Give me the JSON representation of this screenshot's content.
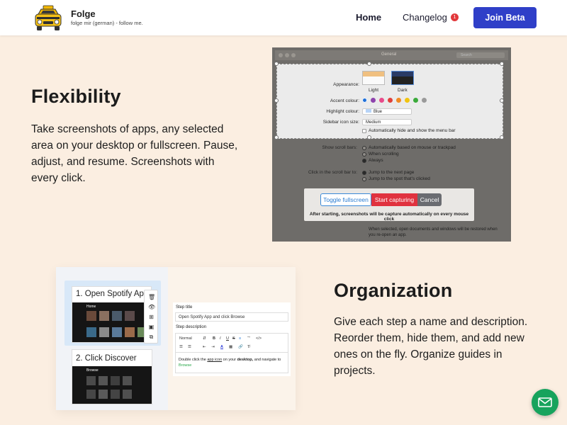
{
  "header": {
    "brand": "Folge",
    "tagline": "folge mir (german) - follow me.",
    "nav": {
      "home": "Home",
      "changelog": "Changelog",
      "changelog_badge": "1"
    },
    "cta": "Join Beta"
  },
  "flexibility": {
    "title": "Flexibility",
    "text": "Take screenshots of apps, any selected area on your desktop or fullscreen. Pause, adjust, and resume. Screenshots with every click."
  },
  "organization": {
    "title": "Organization",
    "text": "Give each step a name and description. Reorder them, hide them, and add new ones on the fly. Organize guides in projects."
  },
  "settings_window": {
    "title": "General",
    "search_placeholder": "Search",
    "appearance_label": "Appearance:",
    "light": "Light",
    "dark": "Dark",
    "accent_label": "Accent colour:",
    "accent_colors": [
      "#1e6fd8",
      "#8e44ad",
      "#e84b8a",
      "#e0403a",
      "#f08a24",
      "#f1c40f",
      "#3aaa3a",
      "#9a9a9a"
    ],
    "highlight_label": "Highlight colour:",
    "highlight_value": "Blue",
    "sidebar_label": "Sidebar icon size:",
    "sidebar_value": "Medium",
    "menu_bar_option": "Automatically hide and show the menu bar",
    "scroll_label": "Show scroll bars:",
    "scroll_options": [
      "Automatically based on mouse or trackpad",
      "When scrolling",
      "Always"
    ],
    "click_label": "Click in the scroll bar to:",
    "click_options": [
      "Jump to the next page",
      "Jump to the spot that's clicked"
    ],
    "restore_note": "When selected, open documents and windows will be restored when you re-open an app."
  },
  "capture_bar": {
    "toggle": "Toggle fullscreen",
    "start": "Start capturing",
    "cancel": "Cancel",
    "note": "After starting, screenshots will be capture automatically on every mouse click"
  },
  "guide_editor": {
    "step1_title": "1. Open Spotify Ap...",
    "step2_title": "2. Click Discover",
    "app_home_label": "Home",
    "app_browse_label": "Browse",
    "step_title_label": "Step title",
    "step_title_value": "Open Spotify App and click Browse",
    "step_desc_label": "Step description",
    "toolbar_style": "Normal",
    "desc_before": "Double click the ",
    "desc_link": "app icon",
    "desc_middle": " on your ",
    "desc_bold": "desktop,",
    "desc_after": " and navigate to",
    "desc_green": "Browse"
  },
  "colors": {
    "accent": "#2f3fc8",
    "background": "#fbeee1",
    "fab": "#17a35d",
    "badge": "#e2383b"
  },
  "icons": {
    "logo": "yellow-taxi-logo",
    "fab": "envelope-icon"
  }
}
